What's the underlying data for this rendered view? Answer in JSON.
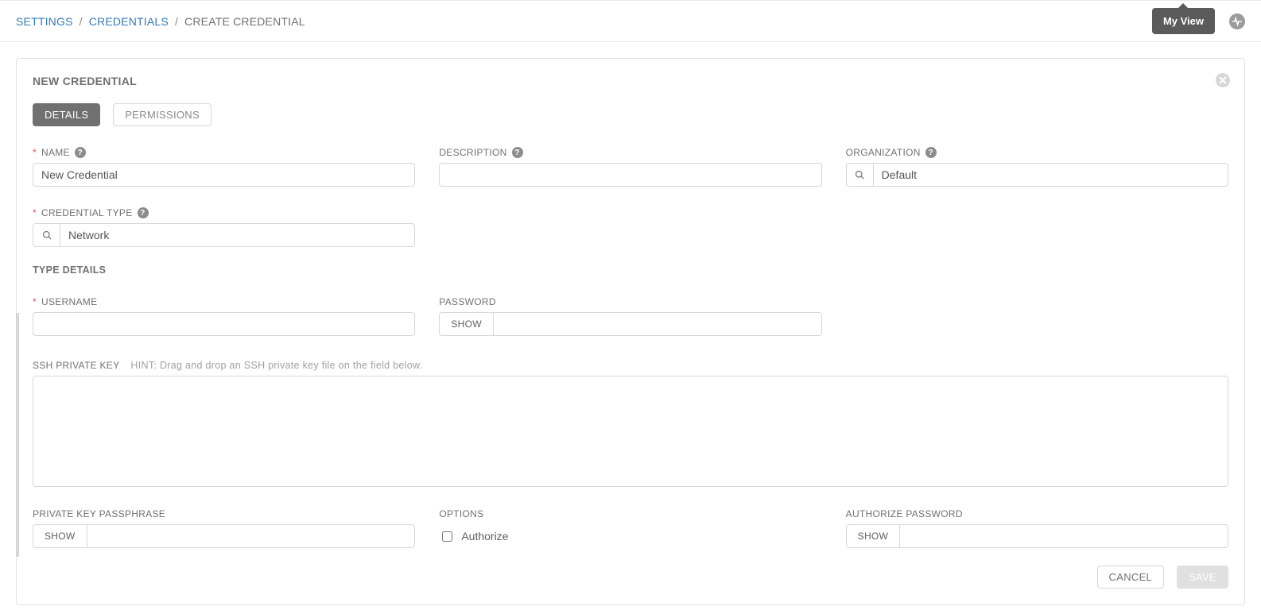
{
  "breadcrumb": {
    "root": "SETTINGS",
    "mid": "CREDENTIALS",
    "current": "CREATE CREDENTIAL"
  },
  "topbar": {
    "my_view": "My View"
  },
  "panel": {
    "title": "NEW CREDENTIAL",
    "tabs": {
      "details": "DETAILS",
      "permissions": "PERMISSIONS"
    }
  },
  "fields": {
    "name": {
      "label": "NAME",
      "value": "New Credential"
    },
    "description": {
      "label": "DESCRIPTION",
      "value": ""
    },
    "organization": {
      "label": "ORGANIZATION",
      "value": "Default"
    },
    "credential_type": {
      "label": "CREDENTIAL TYPE",
      "value": "Network"
    }
  },
  "type_details_header": "TYPE DETAILS",
  "type_details": {
    "username": {
      "label": "USERNAME",
      "value": ""
    },
    "password": {
      "label": "PASSWORD",
      "show": "SHOW",
      "value": ""
    },
    "ssh_key": {
      "label": "SSH PRIVATE KEY",
      "hint": "HINT: Drag and drop an SSH private key file on the field below.",
      "value": ""
    },
    "passphrase": {
      "label": "PRIVATE KEY PASSPHRASE",
      "show": "SHOW",
      "value": ""
    },
    "options": {
      "label": "OPTIONS",
      "authorize_label": "Authorize",
      "authorize_checked": false
    },
    "authorize_password": {
      "label": "AUTHORIZE PASSWORD",
      "show": "SHOW",
      "value": ""
    }
  },
  "footer": {
    "cancel": "CANCEL",
    "save": "SAVE"
  }
}
